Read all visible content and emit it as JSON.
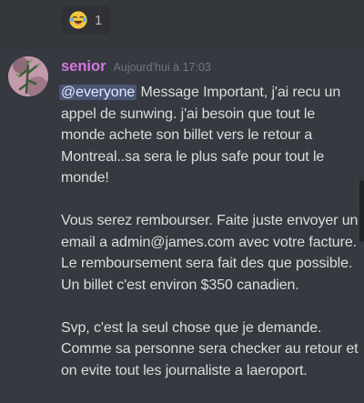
{
  "reaction": {
    "emoji": "laughing-crying-emoji",
    "count": "1"
  },
  "message": {
    "username": "senior",
    "timestamp": "Aujourd'hui à 17:03",
    "mention": "@everyone",
    "paragraph_1_rest": " Message Important, j'ai recu un appel de sunwing. j'ai besoin que tout le monde achete son billet vers le retour a Montreal..sa sera le plus safe pour tout le monde!",
    "paragraph_2": "Vous serez rembourser. Faite juste envoyer un email a admin@james.com avec votre facture. Le remboursement sera fait des que possible. Un billet c'est environ $350 canadien.",
    "paragraph_3": "Svp, c'est la seul chose que je demande. Comme sa personne sera checker au retour et on evite tout les journaliste a laeroport."
  },
  "colors": {
    "background": "#36393f",
    "username": "#d676e3",
    "timestamp": "#72767d",
    "text": "#dcddde",
    "mention_bg": "#4e5d94"
  }
}
